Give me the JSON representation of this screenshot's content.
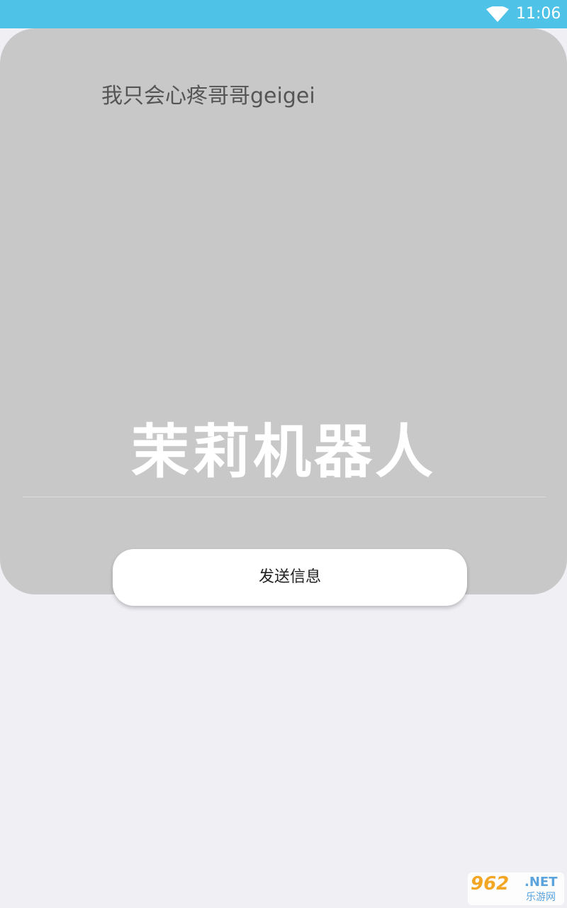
{
  "status_bar": {
    "time": "11:06",
    "wifi_icon": "wifi-icon",
    "color": "#4fc3e7"
  },
  "card": {
    "message": "我只会心疼哥哥geigei",
    "title": "茉莉机器人",
    "background": "#c8c8c8"
  },
  "actions": {
    "send_label": "发送信息"
  },
  "watermark": {
    "logo": "962",
    "net": ".NET",
    "sub": "乐游网"
  }
}
